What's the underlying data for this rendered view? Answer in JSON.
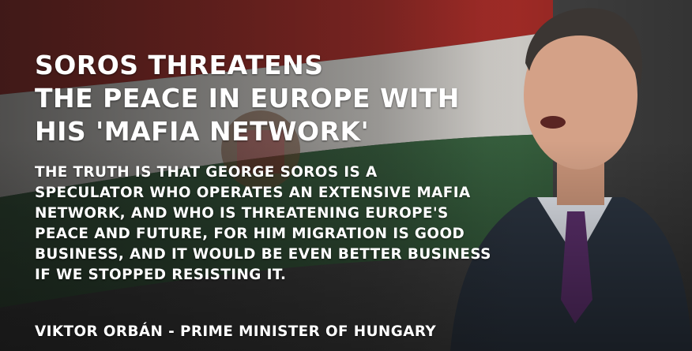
{
  "headline": {
    "lines": [
      "SOROS THREATENS",
      "THE PEACE IN EUROPE WITH",
      "HIS 'MAFIA NETWORK'"
    ]
  },
  "quote": {
    "lines": [
      "THE TRUTH IS THAT GEORGE SOROS IS A",
      "SPECULATOR WHO OPERATES AN EXTENSIVE MAFIA",
      "NETWORK, AND WHO IS THREATENING EUROPE'S",
      "PEACE AND FUTURE, FOR HIM MIGRATION IS GOOD",
      "BUSINESS, AND IT WOULD BE EVEN BETTER BUSINESS",
      "IF WE STOPPED RESISTING IT."
    ]
  },
  "attribution": "VIKTOR ORBÁN - PRIME MINISTER OF HUNGARY",
  "colors": {
    "flag_red": "#b5302b",
    "flag_white": "#e9e6e1",
    "flag_green": "#3d6b45",
    "text": "#ffffff",
    "suit": "#2b3440",
    "tie": "#5b2f6b"
  }
}
